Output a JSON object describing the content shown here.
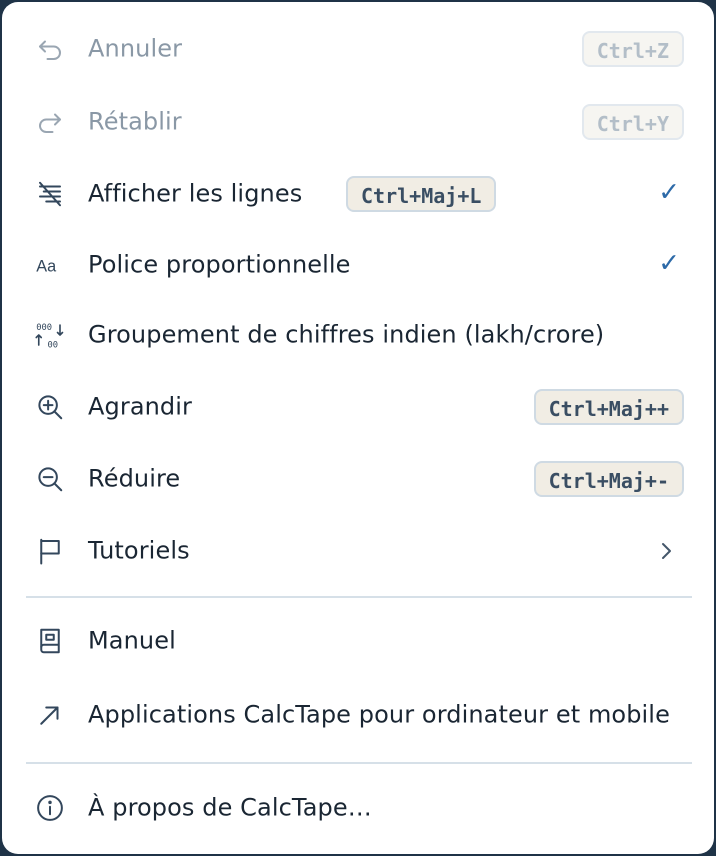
{
  "menu": {
    "undo": {
      "label": "Annuler",
      "shortcut": "Ctrl+Z",
      "icon": "undo-icon"
    },
    "redo": {
      "label": "Rétablir",
      "shortcut": "Ctrl+Y",
      "icon": "redo-icon"
    },
    "show_lines": {
      "label": "Afficher les lignes",
      "shortcut": "Ctrl+Maj+L",
      "checked": "✓",
      "icon": "lines-icon"
    },
    "proportional_font": {
      "label": "Police proportionnelle",
      "checked": "✓",
      "icon": "font-icon"
    },
    "indian_grouping": {
      "label": "Groupement de chiffres indien (lakh/crore)",
      "icon": "digit-grouping-icon"
    },
    "zoom_in": {
      "label": "Agrandir",
      "shortcut": "Ctrl+Maj++",
      "icon": "zoom-in-icon"
    },
    "zoom_out": {
      "label": "Réduire",
      "shortcut": "Ctrl+Maj+-",
      "icon": "zoom-out-icon"
    },
    "tutorials": {
      "label": "Tutoriels",
      "icon": "flag-icon"
    },
    "manual": {
      "label": "Manuel",
      "icon": "book-icon"
    },
    "apps": {
      "label": "Applications CalcTape pour ordinateur et mobile",
      "icon": "external-arrow-icon"
    },
    "about": {
      "label": "À propos de CalcTape…",
      "icon": "info-icon"
    }
  },
  "colors": {
    "checkmark": "#2d6aa8",
    "kbd_background": "#f1ede4",
    "kbd_border": "#cfdae3",
    "text": "#1a2633",
    "disabled_text": "#8a98a6"
  }
}
